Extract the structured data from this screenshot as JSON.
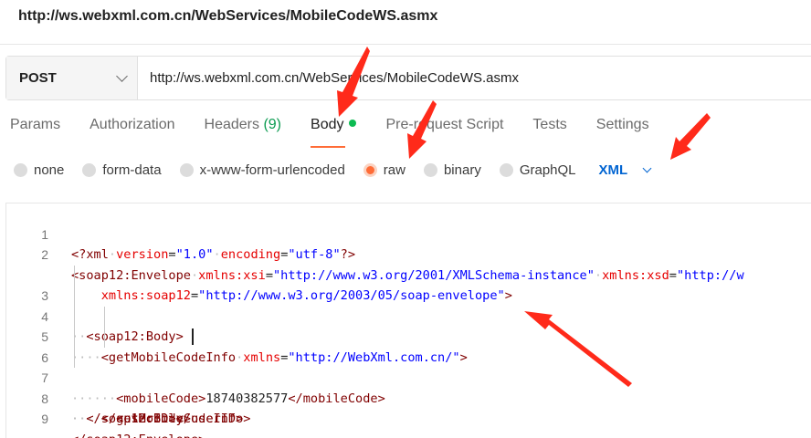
{
  "page": {
    "title": "http://ws.webxml.com.cn/WebServices/MobileCodeWS.asmx"
  },
  "request": {
    "method": "POST",
    "url": "http://ws.webxml.com.cn/WebServices/MobileCodeWS.asmx"
  },
  "tabs": [
    {
      "label": "Params",
      "active": false
    },
    {
      "label": "Authorization",
      "active": false
    },
    {
      "label": "Headers",
      "count": "(9)",
      "active": false
    },
    {
      "label": "Body",
      "active": true
    },
    {
      "label": "Pre-request Script",
      "active": false
    },
    {
      "label": "Tests",
      "active": false
    },
    {
      "label": "Settings",
      "active": false
    }
  ],
  "body_types": {
    "options": [
      {
        "label": "none",
        "selected": false
      },
      {
        "label": "form-data",
        "selected": false
      },
      {
        "label": "x-www-form-urlencoded",
        "selected": false
      },
      {
        "label": "raw",
        "selected": true
      },
      {
        "label": "binary",
        "selected": false
      },
      {
        "label": "GraphQL",
        "selected": false
      }
    ],
    "raw_language": "XML"
  },
  "editor": {
    "line_numbers": [
      "1",
      "2",
      "",
      "3",
      "4",
      "5",
      "6",
      "7",
      "8",
      "9"
    ],
    "lines": [
      "<?xml version=\"1.0\" encoding=\"utf-8\"?>",
      "<soap12:Envelope xmlns:xsi=\"http://www.w3.org/2001/XMLSchema-instance\" xmlns:xsd=\"http://w",
      "    xmlns:soap12=\"http://www.w3.org/2003/05/soap-envelope\">",
      "  <soap12:Body>",
      "    <getMobileCodeInfo xmlns=\"http://WebXml.com.cn/\">",
      "      <mobileCode>18740382577</mobileCode>",
      "      <userID></userID>",
      "    </getMobileCodeInfo>",
      "  </soap12:Body>",
      "</soap12:Envelope>"
    ]
  },
  "colors": {
    "accent": "#ff6c37",
    "annotation_arrow": "#ff2a1a",
    "link_blue": "#0265d2",
    "xml_tag": "#800000",
    "xml_attribute": "#e50000",
    "xml_string": "#0000ff"
  }
}
